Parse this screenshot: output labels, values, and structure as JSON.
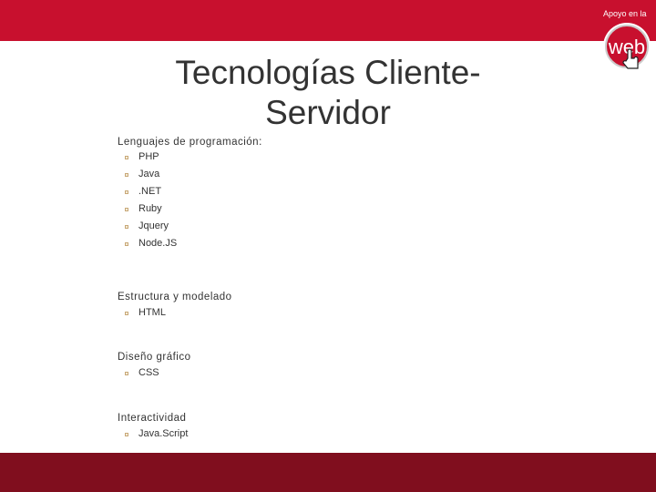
{
  "logo": {
    "text": "Apoyo en la",
    "word": "web"
  },
  "title": "Tecnologías Cliente-Servidor",
  "title_lines": [
    "Tecnologías Cliente-",
    "Servidor"
  ],
  "sections": [
    {
      "heading": "Lenguajes de programación:",
      "items": [
        "PHP",
        "Java",
        ".NET",
        "Ruby",
        "Jquery",
        "Node.JS"
      ]
    },
    {
      "heading": "Estructura y modelado",
      "items": [
        "HTML"
      ]
    },
    {
      "heading": "Diseño gráfico",
      "items": [
        "CSS"
      ]
    },
    {
      "heading": "Interactividad",
      "items": [
        "Java.Script"
      ]
    }
  ],
  "colors": {
    "header": "#C8102E",
    "footer": "#800E1E",
    "bullet": "#C8A878"
  }
}
